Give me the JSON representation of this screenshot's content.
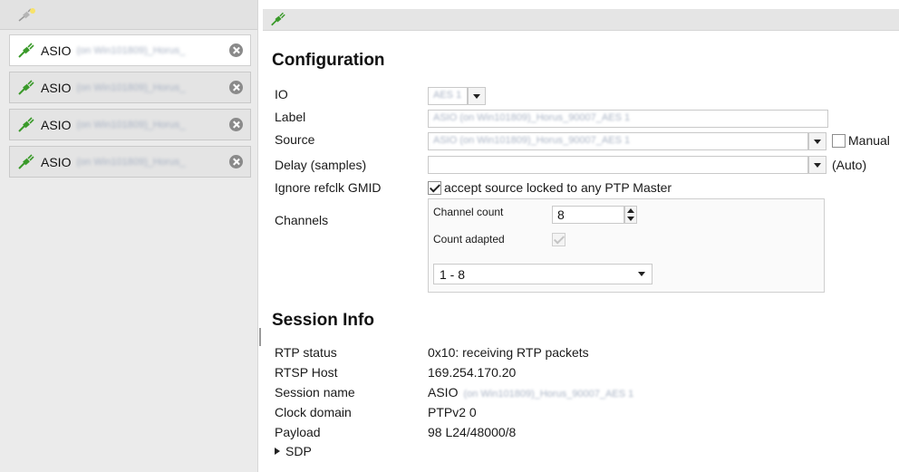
{
  "sidebar": {
    "toolbar_icon": "plug-add-icon",
    "items": [
      {
        "label": "ASIO",
        "detail": "(on Win101809)_Horus_",
        "selected": true
      },
      {
        "label": "ASIO",
        "detail": "(on Win101809)_Horus_",
        "selected": false
      },
      {
        "label": "ASIO",
        "detail": "(on Win101809)_Horus_",
        "selected": false
      },
      {
        "label": "ASIO",
        "detail": "(on Win101809)_Horus_",
        "selected": false
      }
    ]
  },
  "main": {
    "toolbar_icon": "plug-icon",
    "configuration": {
      "heading": "Configuration",
      "io": {
        "label": "IO",
        "value": "AES 1"
      },
      "name": {
        "label": "Label",
        "value": "ASIO (on Win101809)_Horus_90007_AES 1"
      },
      "source": {
        "label": "Source",
        "value": "ASIO (on Win101809)_Horus_90007_AES 1",
        "manual_label": "Manual",
        "manual_checked": false
      },
      "delay": {
        "label": "Delay (samples)",
        "value": "",
        "auto_label": "(Auto)"
      },
      "ignore_refclk": {
        "label": "Ignore refclk GMID",
        "checkbox_label": "accept source locked to any PTP Master",
        "checked": true
      },
      "channels": {
        "label": "Channels",
        "count_label": "Channel count",
        "count_value": "8",
        "adapted_label": "Count adapted",
        "adapted_checked": true,
        "range_value": "1 - 8"
      }
    },
    "session_info": {
      "heading": "Session Info",
      "rows": [
        {
          "label": "RTP status",
          "value": "0x10: receiving RTP packets"
        },
        {
          "label": "RTSP Host",
          "value": "169.254.170.20"
        },
        {
          "label": "Session name",
          "value": "ASIO",
          "detail": "(on Win101809)_Horus_90007_AES 1"
        },
        {
          "label": "Clock domain",
          "value": "PTPv2 0"
        },
        {
          "label": "Payload",
          "value": "98 L24/48000/8"
        }
      ],
      "sdp_label": "SDP"
    }
  },
  "colors": {
    "accent_green": "#3a9a2a",
    "selected_bg": "#ffffff",
    "sidebar_bg": "#ebebeb"
  }
}
